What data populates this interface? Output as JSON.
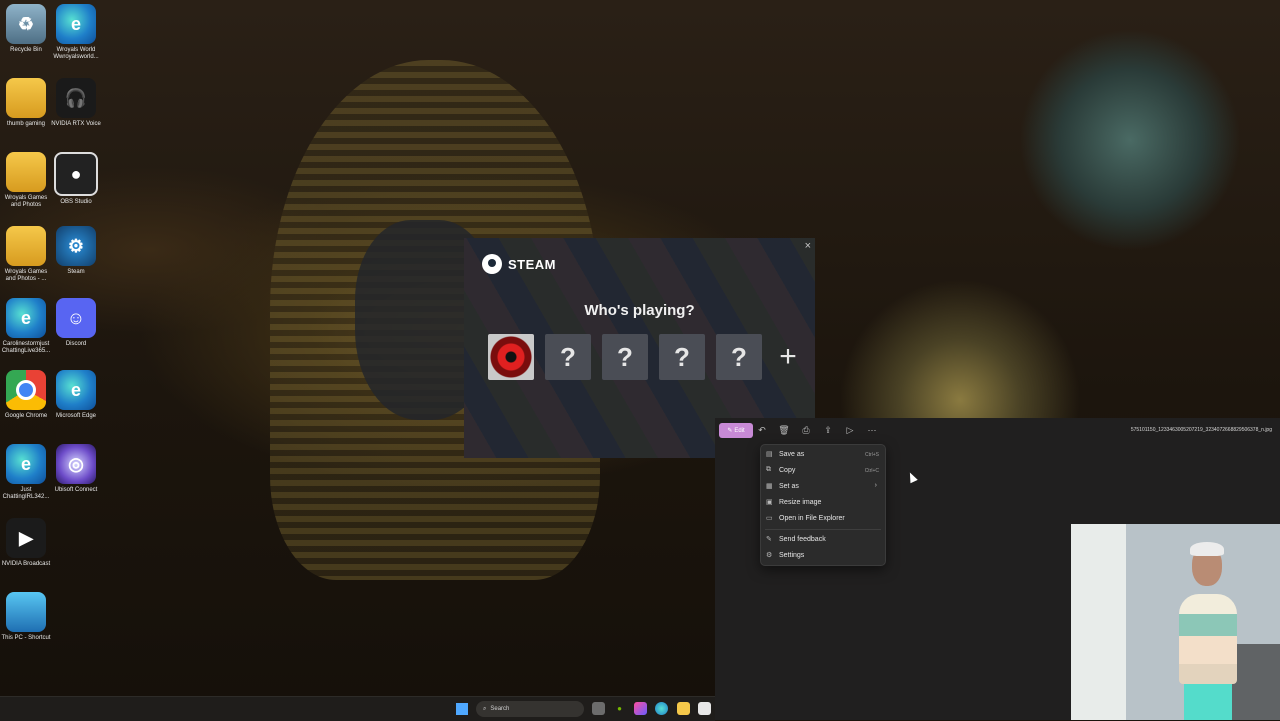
{
  "desktop": {
    "icons": [
      {
        "label": "Recycle Bin",
        "glyph": "♻"
      },
      {
        "label": "Wroyals World Wwroyalsworld...",
        "glyph": "e"
      },
      {
        "label": "thumb gaming",
        "glyph": ""
      },
      {
        "label": "NVIDIA RTX Voice",
        "glyph": "🎧"
      },
      {
        "label": "Wroyals Games and Photos",
        "glyph": ""
      },
      {
        "label": "OBS Studio",
        "glyph": "●"
      },
      {
        "label": "Wroyals Games and Photos - ...",
        "glyph": ""
      },
      {
        "label": "Steam",
        "glyph": "⚙"
      },
      {
        "label": "Carolinestormjust ChattingLive365...",
        "glyph": "e"
      },
      {
        "label": "Discord",
        "glyph": "☺"
      },
      {
        "label": "Google Chrome",
        "glyph": ""
      },
      {
        "label": "Microsoft Edge",
        "glyph": "e"
      },
      {
        "label": "Just ChattingIRL342...",
        "glyph": "e"
      },
      {
        "label": "Ubisoft Connect",
        "glyph": "◎"
      },
      {
        "label": "NVIDIA Broadcast",
        "glyph": "▶"
      },
      {
        "label": "This PC - Shortcut",
        "glyph": ""
      }
    ]
  },
  "steam": {
    "brand": "STEAM",
    "close": "×",
    "title": "Who's playing?",
    "unknown": "?",
    "add": "+"
  },
  "photos": {
    "edit_label": "Edit",
    "filename": "575101150_1233463005207219_3234072668829506378_n.jpg",
    "toolbar_icons": [
      "↶",
      "🗑",
      "⎙",
      "⇪",
      "▷",
      "⋯"
    ],
    "menu": [
      {
        "label": "Save as",
        "shortcut": "Ctrl+S",
        "icon": "▤"
      },
      {
        "label": "Copy",
        "shortcut": "Ctrl+C",
        "icon": "⧉"
      },
      {
        "label": "Set as",
        "shortcut": "",
        "icon": "▦",
        "submenu": true
      },
      {
        "label": "Resize image",
        "shortcut": "",
        "icon": "▣"
      },
      {
        "label": "Open in File Explorer",
        "shortcut": "",
        "icon": "▭"
      },
      {
        "label": "Send feedback",
        "shortcut": "",
        "icon": "✎"
      },
      {
        "label": "Settings",
        "shortcut": "",
        "icon": "⚙"
      }
    ]
  },
  "taskbar": {
    "search_placeholder": "Search"
  },
  "colors": {
    "accent_edit": "#c88ad6",
    "steam_bg": "#2b2e37",
    "menu_bg": "#2b2b2b"
  }
}
